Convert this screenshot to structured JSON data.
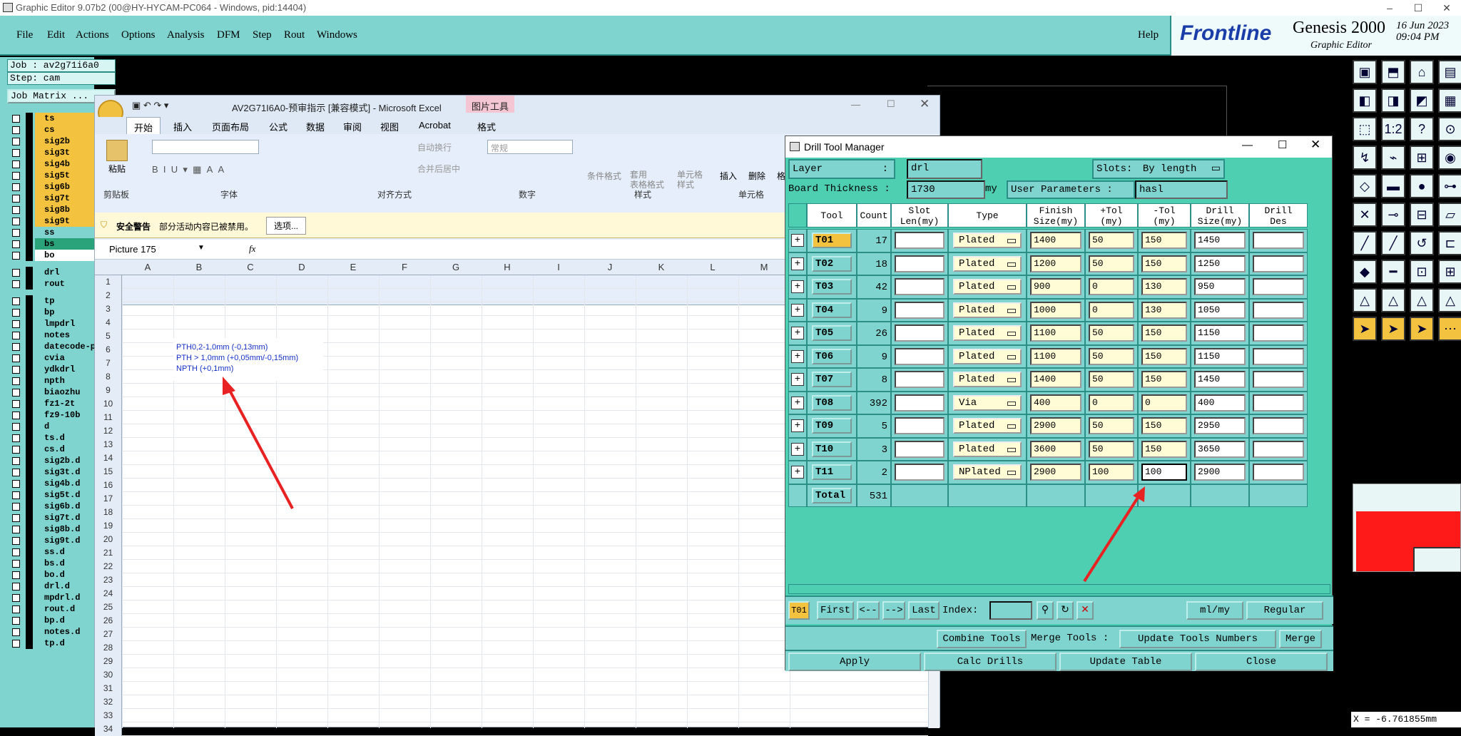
{
  "outer": {
    "title": "Graphic Editor 9.07b2 (00@HY-HYCAM-PC064 - Windows, pid:14404)"
  },
  "menubar": {
    "items": [
      "File",
      "Edit",
      "Actions",
      "Options",
      "Analysis",
      "DFM",
      "Step",
      "Rout",
      "Windows"
    ],
    "help": "Help",
    "brand": "Frontline",
    "product": "Genesis 2000",
    "subtitle": "Graphic Editor",
    "date": "16 Jun 2023",
    "time": "09:04 PM"
  },
  "job": {
    "job": "Job : av2g71i6a0",
    "step": "Step: cam",
    "matrix": "Job Matrix ..."
  },
  "layers": [
    {
      "name": "ts",
      "color": "#f3c340"
    },
    {
      "name": "cs",
      "color": "#f3c340"
    },
    {
      "name": "sig2b",
      "color": "#f3c340"
    },
    {
      "name": "sig3t",
      "color": "#f3c340"
    },
    {
      "name": "sig4b",
      "color": "#f3c340"
    },
    {
      "name": "sig5t",
      "color": "#f3c340"
    },
    {
      "name": "sig6b",
      "color": "#f3c340"
    },
    {
      "name": "sig7t",
      "color": "#f3c340"
    },
    {
      "name": "sig8b",
      "color": "#f3c340"
    },
    {
      "name": "sig9t",
      "color": "#f3c340"
    },
    {
      "name": "ss",
      "color": "#7fd4cf"
    },
    {
      "name": "bs",
      "color": "#2aa37a"
    },
    {
      "name": "bo",
      "color": "#ffffff"
    },
    {
      "name": "drl",
      "color": "#7fd4cf"
    },
    {
      "name": "rout",
      "color": "#7fd4cf"
    },
    {
      "name": "tp",
      "color": "#7fd4cf"
    },
    {
      "name": "bp",
      "color": "#7fd4cf"
    },
    {
      "name": "lmpdrl",
      "color": "#7fd4cf"
    },
    {
      "name": "notes",
      "color": "#7fd4cf"
    },
    {
      "name": "datecode-pbe",
      "color": "#7fd4cf"
    },
    {
      "name": "cvia",
      "color": "#7fd4cf"
    },
    {
      "name": "ydkdrl",
      "color": "#7fd4cf"
    },
    {
      "name": "npth",
      "color": "#7fd4cf"
    },
    {
      "name": "biaozhu",
      "color": "#7fd4cf"
    },
    {
      "name": "fz1-2t",
      "color": "#7fd4cf"
    },
    {
      "name": "fz9-10b",
      "color": "#7fd4cf"
    },
    {
      "name": "d",
      "color": "#7fd4cf"
    },
    {
      "name": "ts.d",
      "color": "#7fd4cf"
    },
    {
      "name": "cs.d",
      "color": "#7fd4cf"
    },
    {
      "name": "sig2b.d",
      "color": "#7fd4cf"
    },
    {
      "name": "sig3t.d",
      "color": "#7fd4cf"
    },
    {
      "name": "sig4b.d",
      "color": "#7fd4cf"
    },
    {
      "name": "sig5t.d",
      "color": "#7fd4cf"
    },
    {
      "name": "sig6b.d",
      "color": "#7fd4cf"
    },
    {
      "name": "sig7t.d",
      "color": "#7fd4cf"
    },
    {
      "name": "sig8b.d",
      "color": "#7fd4cf"
    },
    {
      "name": "sig9t.d",
      "color": "#7fd4cf"
    },
    {
      "name": "ss.d",
      "color": "#7fd4cf"
    },
    {
      "name": "bs.d",
      "color": "#7fd4cf"
    },
    {
      "name": "bo.d",
      "color": "#7fd4cf"
    },
    {
      "name": "drl.d",
      "color": "#7fd4cf"
    },
    {
      "name": "mpdrl.d",
      "color": "#7fd4cf"
    },
    {
      "name": "rout.d",
      "color": "#7fd4cf"
    },
    {
      "name": "bp.d",
      "color": "#7fd4cf"
    },
    {
      "name": "notes.d",
      "color": "#7fd4cf"
    },
    {
      "name": "tp.d",
      "color": "#7fd4cf"
    }
  ],
  "excel": {
    "title": "AV2G71I6A0-预审指示 [兼容模式] - Microsoft Excel",
    "context_tab": "图片工具",
    "tabs": [
      "开始",
      "插入",
      "页面布局",
      "公式",
      "数据",
      "审阅",
      "视图",
      "Acrobat",
      "格式"
    ],
    "groups": [
      "剪贴板",
      "字体",
      "对齐方式",
      "数字",
      "样式",
      "单元格"
    ],
    "paste": "粘贴",
    "wrap": "自动换行",
    "merge": "合并后居中",
    "number_format": "常规",
    "cond_format": "条件格式",
    "table_format": "套用\n表格格式",
    "cell_style": "单元格\n样式",
    "insert": "插入",
    "delete": "删除",
    "format_cut": "格式",
    "security_title": "安全警告",
    "security_msg": "部分活动内容已被禁用。",
    "options_btn": "选项...",
    "name_box": "Picture 175",
    "fx": "fx",
    "columns": [
      "A",
      "B",
      "C",
      "D",
      "E",
      "F",
      "G",
      "H",
      "I",
      "J",
      "K",
      "L",
      "M"
    ],
    "rows": [
      "1",
      "2",
      "3",
      "4",
      "5",
      "6",
      "7",
      "8",
      "9",
      "10",
      "11",
      "12",
      "13",
      "14",
      "15",
      "16",
      "17",
      "18",
      "19",
      "20",
      "21",
      "22",
      "23",
      "24",
      "25",
      "26",
      "27",
      "28",
      "29",
      "30",
      "31",
      "32",
      "33",
      "34"
    ],
    "note_lines": [
      "PTH0,2-1,0mm  (-0,13mm)",
      "PTH > 1,0mm  (+0,05mm/-0,15mm)",
      "NPTH  (+0,1mm)"
    ]
  },
  "dtm": {
    "title": "Drill Tool Manager",
    "layer_label": "Layer",
    "layer_value": "drl",
    "slots_label": "Slots:",
    "slots_value": "By length",
    "thickness_label": "Board Thickness :",
    "thickness_value": "1730",
    "thickness_unit": "my",
    "user_params_label": "User Parameters :",
    "user_params_value": "hasl",
    "headers": [
      "Tool",
      "Count",
      "Slot\nLen(my)",
      "Type",
      "Finish\nSize(my)",
      "+Tol\n(my)",
      "-Tol\n(my)",
      "Drill\nSize(my)",
      "Drill\nDes"
    ],
    "rows": [
      {
        "tool": "T01",
        "count": "17",
        "type": "Plated",
        "finish": "1400",
        "ptol": "50",
        "mtol": "150",
        "drill": "1450"
      },
      {
        "tool": "T02",
        "count": "18",
        "type": "Plated",
        "finish": "1200",
        "ptol": "50",
        "mtol": "150",
        "drill": "1250"
      },
      {
        "tool": "T03",
        "count": "42",
        "type": "Plated",
        "finish": "900",
        "ptol": "0",
        "mtol": "130",
        "drill": "950"
      },
      {
        "tool": "T04",
        "count": "9",
        "type": "Plated",
        "finish": "1000",
        "ptol": "0",
        "mtol": "130",
        "drill": "1050"
      },
      {
        "tool": "T05",
        "count": "26",
        "type": "Plated",
        "finish": "1100",
        "ptol": "50",
        "mtol": "150",
        "drill": "1150"
      },
      {
        "tool": "T06",
        "count": "9",
        "type": "Plated",
        "finish": "1100",
        "ptol": "50",
        "mtol": "150",
        "drill": "1150"
      },
      {
        "tool": "T07",
        "count": "8",
        "type": "Plated",
        "finish": "1400",
        "ptol": "50",
        "mtol": "150",
        "drill": "1450"
      },
      {
        "tool": "T08",
        "count": "392",
        "type": "Via",
        "finish": "400",
        "ptol": "0",
        "mtol": "0",
        "drill": "400"
      },
      {
        "tool": "T09",
        "count": "5",
        "type": "Plated",
        "finish": "2900",
        "ptol": "50",
        "mtol": "150",
        "drill": "2950"
      },
      {
        "tool": "T10",
        "count": "3",
        "type": "Plated",
        "finish": "3600",
        "ptol": "50",
        "mtol": "150",
        "drill": "3650"
      },
      {
        "tool": "T11",
        "count": "2",
        "type": "NPlated",
        "finish": "2900",
        "ptol": "100",
        "mtol": "100",
        "drill": "2900"
      }
    ],
    "total_label": "Total",
    "total_count": "531",
    "nav": {
      "current": "T01",
      "first": "First",
      "prev": "<--",
      "next": "-->",
      "last": "Last",
      "index": "Index:",
      "units": "ml/my",
      "mode": "Regular"
    },
    "combine": "Combine Tools",
    "merge_tools": "Merge Tools :",
    "update_numbers": "Update Tools Numbers",
    "merge": "Merge",
    "apply": "Apply",
    "calc": "Calc Drills",
    "update_table": "Update Table",
    "close": "Close"
  },
  "status": {
    "coord": "X = -6.761855mm"
  }
}
